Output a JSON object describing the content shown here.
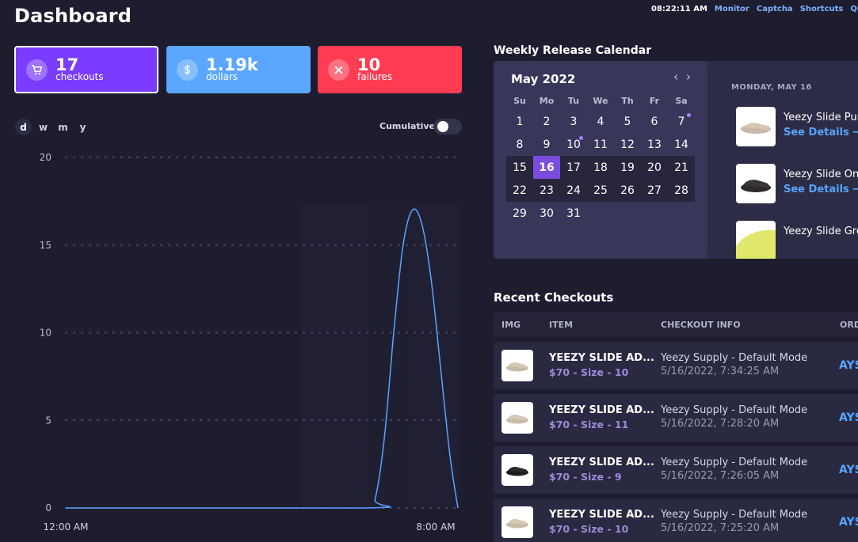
{
  "page": {
    "title": "Dashboard"
  },
  "top_bar": {
    "clock": "08:22:11 AM",
    "links": [
      "Monitor",
      "Captcha",
      "Shortcuts",
      "Qu"
    ]
  },
  "stats": [
    {
      "value": "17",
      "label": "checkouts",
      "icon": "cart-icon",
      "color": "#7a3cff"
    },
    {
      "value": "1.19k",
      "label": "dollars",
      "icon": "dollar-icon",
      "color": "#5ba7ff"
    },
    {
      "value": "10",
      "label": "failures",
      "icon": "x-icon",
      "color": "#ff3c52"
    }
  ],
  "range_tabs": [
    "d",
    "w",
    "m",
    "y"
  ],
  "range_selected": "d",
  "cumulative": {
    "label": "Cumulative",
    "on": false
  },
  "chart_data": {
    "type": "line",
    "title": "",
    "xlabel": "",
    "ylabel": "",
    "x_tick_labels": [
      "12:00 AM",
      "8:00 AM"
    ],
    "y_ticks": [
      0,
      5,
      10,
      15,
      20
    ],
    "ylim": [
      0,
      20
    ],
    "grid": "horizontal dotted",
    "color": "#5aa3ff",
    "x": [
      0,
      6.4,
      6.6,
      6.8,
      7.0,
      7.2,
      7.4,
      7.6,
      7.8,
      8.0,
      8.2,
      8.37
    ],
    "y": [
      0,
      0,
      0.5,
      4,
      10,
      15,
      17,
      16.2,
      13,
      8,
      3,
      0
    ]
  },
  "calendar": {
    "title": "Weekly Release Calendar",
    "month": "May 2022",
    "weekdays": [
      "Su",
      "Mo",
      "Tu",
      "We",
      "Th",
      "Fr",
      "Sa"
    ],
    "weeks": [
      [
        "1",
        "2",
        "3",
        "4",
        "5",
        "6",
        "7"
      ],
      [
        "8",
        "9",
        "10",
        "11",
        "12",
        "13",
        "14"
      ],
      [
        "15",
        "16",
        "17",
        "18",
        "19",
        "20",
        "21"
      ],
      [
        "22",
        "23",
        "24",
        "25",
        "26",
        "27",
        "28"
      ],
      [
        "29",
        "30",
        "31",
        "",
        "",
        "",
        ""
      ]
    ],
    "selected_day": "16",
    "event_days": [
      "7",
      "10"
    ],
    "release_date": "MONDAY, MAY 16",
    "releases": [
      {
        "name": "Yeezy Slide Pur",
        "link": "See Details →"
      },
      {
        "name": "Yeezy Slide Ony",
        "link": "See Details →"
      },
      {
        "name": "Yeezy Slide Gre",
        "link": ""
      }
    ]
  },
  "checkouts": {
    "title": "Recent Checkouts",
    "columns": [
      "IMG",
      "ITEM",
      "CHECKOUT INFO",
      "ORD"
    ],
    "rows": [
      {
        "item": "YEEZY SLIDE AD...",
        "price": "$70 - Size - 10",
        "store": "Yeezy Supply - Default Mode",
        "time": "5/16/2022, 7:34:25 AM",
        "order": "AYS",
        "shoe": "bone"
      },
      {
        "item": "YEEZY SLIDE AD...",
        "price": "$70 - Size - 11",
        "store": "Yeezy Supply - Default Mode",
        "time": "5/16/2022, 7:28:20 AM",
        "order": "AYS",
        "shoe": "bone"
      },
      {
        "item": "YEEZY SLIDE AD...",
        "price": "$70 - Size - 9",
        "store": "Yeezy Supply - Default Mode",
        "time": "5/16/2022, 7:26:05 AM",
        "order": "AYS",
        "shoe": "onyx"
      },
      {
        "item": "YEEZY SLIDE AD...",
        "price": "$70 - Size - 10",
        "store": "Yeezy Supply - Default Mode",
        "time": "5/16/2022, 7:25:20 AM",
        "order": "AYS",
        "shoe": "bone"
      }
    ]
  }
}
